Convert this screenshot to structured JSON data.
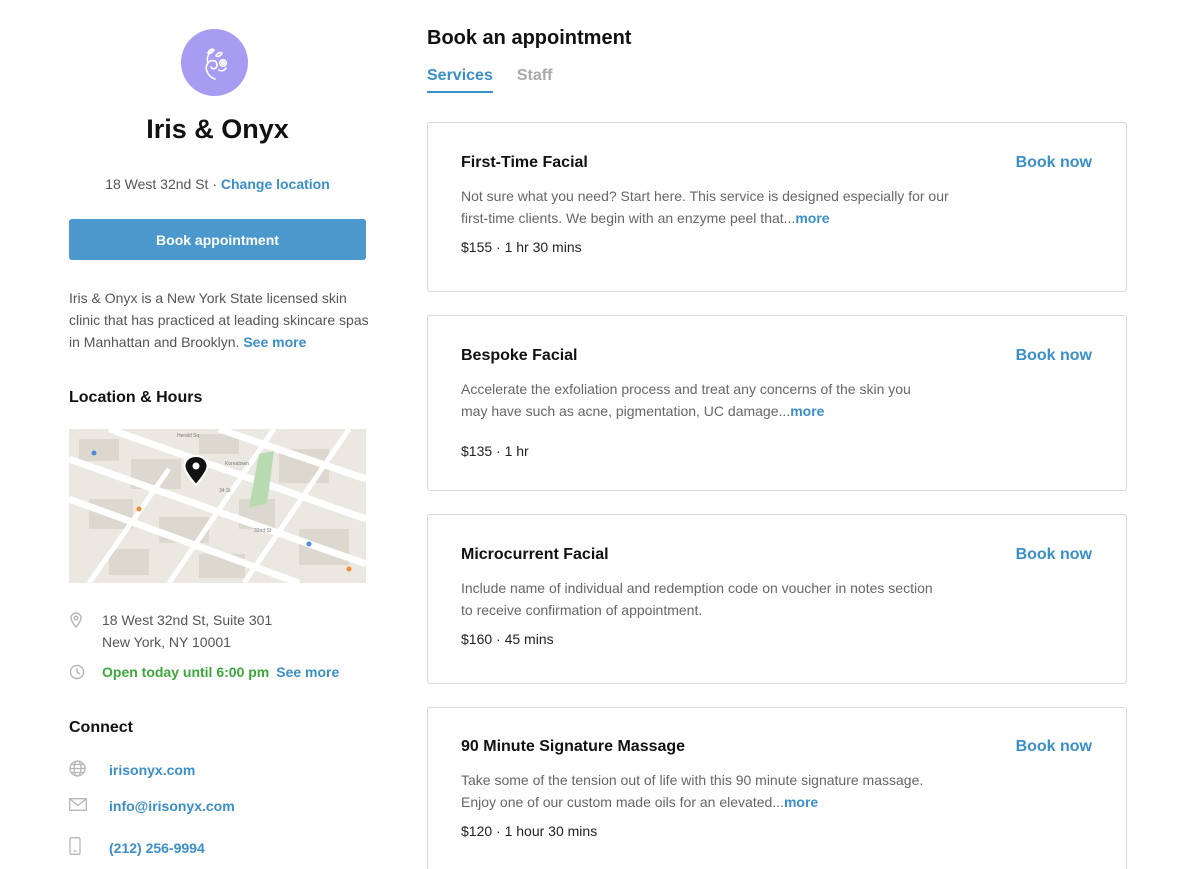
{
  "business": {
    "name": "Iris & Onyx",
    "address_short": "18 West 32nd St",
    "separator": "·",
    "change_location": "Change location",
    "book_button": "Book appointment",
    "about": "Iris & Onyx is a New York State licensed skin clinic that has practiced at leading skincare spas in Manhattan and Brooklyn.",
    "about_more": "See more",
    "logo_icon": "leaf-swirl-logo"
  },
  "location": {
    "heading": "Location & Hours",
    "address_line1": "18 West 32nd St, Suite 301",
    "address_line2": "New York, NY 10001",
    "hours": "Open today until 6:00 pm",
    "hours_more": "See more",
    "pin_icon": "location-pin-icon",
    "clock_icon": "clock-icon",
    "map_labels": [
      "Herald Sq",
      "Koreatown",
      "34 St",
      "32nd St"
    ]
  },
  "connect": {
    "heading": "Connect",
    "website": "irisonyx.com",
    "email": "info@irisonyx.com",
    "phone": "(212) 256-9994"
  },
  "main": {
    "title": "Book an appointment",
    "tabs": [
      {
        "label": "Services",
        "active": true
      },
      {
        "label": "Staff",
        "active": false
      }
    ],
    "book_now_label": "Book now",
    "more_label": "more",
    "services": [
      {
        "name": "First-Time Facial",
        "description": "Not sure what you need? Start here. This service is designed especially for our first-time clients. We begin with an enzyme peel that...",
        "truncated": true,
        "price_duration": "$155 · 1 hr 30 mins"
      },
      {
        "name": "Bespoke Facial",
        "description": "Accelerate the exfoliation process and treat any concerns of the skin you may have such as acne, pigmentation, UC damage...",
        "truncated": true,
        "price_duration": "$135 · 1 hr"
      },
      {
        "name": "Microcurrent Facial",
        "description": "Include name of individual and redemption code on voucher in notes section to receive confirmation of appointment.",
        "truncated": false,
        "price_duration": "$160 · 45 mins"
      },
      {
        "name": "90 Minute Signature Massage",
        "description": "Take some of the tension out of life with this 90 minute signature massage. Enjoy one of our custom made oils for an elevated...",
        "truncated": true,
        "price_duration": "$120 · 1 hour 30 mins"
      }
    ]
  },
  "colors": {
    "accent": "#3a8fc9",
    "button": "#4a98cc",
    "logo_bg": "#a89cf2",
    "open_green": "#3ca83a"
  }
}
